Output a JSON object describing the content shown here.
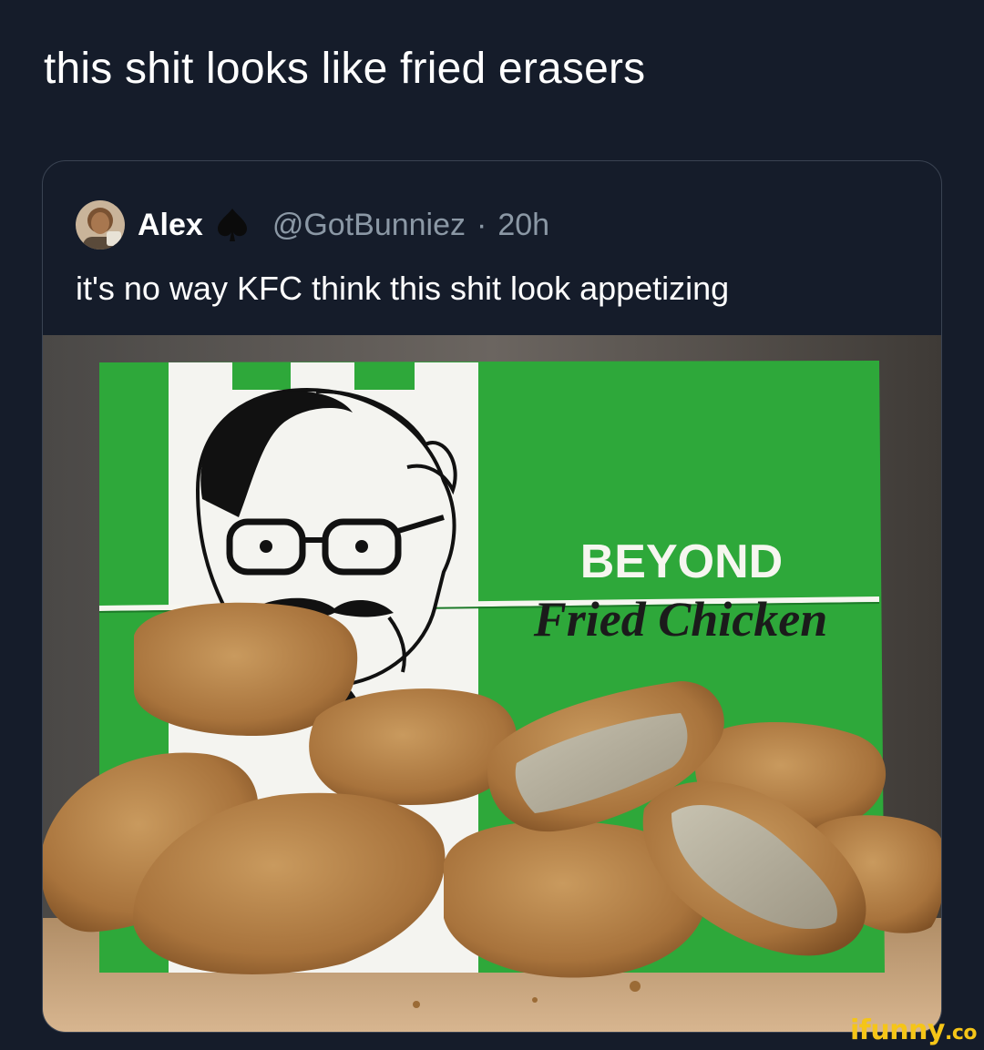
{
  "main_tweet": {
    "text": "this shit looks like fried erasers"
  },
  "quoted_tweet": {
    "display_name": "Alex",
    "badge_icon": "spade-icon",
    "handle": "@GotBunniez",
    "separator": "·",
    "time": "20h",
    "text": "it's no way KFC think this shit look appetizing",
    "media": {
      "box_line1": "BEYOND",
      "box_line2": "Fried Chicken"
    }
  },
  "watermark": {
    "text": "ifunny",
    "suffix": ".co"
  },
  "colors": {
    "background": "#151c2a",
    "muted_text": "#8b98a5",
    "box_green": "#2ea83a",
    "watermark": "#f5c518"
  }
}
